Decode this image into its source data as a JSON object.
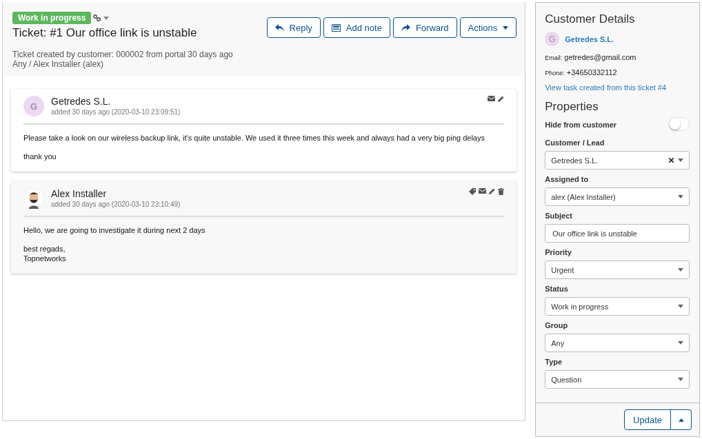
{
  "ticket": {
    "status_badge": "Work in progress",
    "title": "Ticket: #1 Our office link is unstable",
    "created": "Ticket created by customer: 000002 from portal 30 days ago",
    "assignment": "Any / Alex Installer (alex)"
  },
  "toolbar": [
    {
      "kind": "reply",
      "label": "Reply"
    },
    {
      "kind": "note",
      "label": "Add note"
    },
    {
      "kind": "forward",
      "label": "Forward"
    },
    {
      "kind": "dropdown",
      "label": "Actions"
    }
  ],
  "messages": [
    {
      "kind": "customer",
      "author": "Getredes S.L.",
      "avatar_letter": "G",
      "added": "added 30 days ago (2020-03-10 23:09:51)",
      "paragraphs": [
        "Please take a look on our wireless backup link, it's quite unstable. We used it three times this week and always had a very big ping delays",
        "thank you"
      ],
      "actions": [
        {
          "kind": "mail"
        },
        {
          "kind": "edit"
        }
      ]
    },
    {
      "kind": "agent",
      "author": "Alex Installer",
      "added": "added 30 days ago (2020-03-10 23:10:49)",
      "paragraphs": [
        "Hello, we are going to investigate it during next 2 days",
        "best regads,\nTopnetworks"
      ],
      "actions": [
        {
          "kind": "tag"
        },
        {
          "kind": "mail"
        },
        {
          "kind": "edit"
        },
        {
          "kind": "delete"
        }
      ]
    }
  ],
  "customer_details": {
    "title": "Customer Details",
    "avatar_letter": "G",
    "name": "Getredes S.L.",
    "email_label": "Email:",
    "email": "getredes@gmail.com",
    "phone_label": "Phone:",
    "phone": "+34650332112",
    "task_link": "View task created from this ticket #4"
  },
  "properties": {
    "title": "Properties",
    "fields": [
      {
        "kind": "toggle",
        "label": "Hide from customer",
        "on": false
      },
      {
        "kind": "select",
        "label": "Customer / Lead",
        "value": "Getredes S.L.",
        "clearable": true
      },
      {
        "kind": "select",
        "label": "Assigned to",
        "value": "alex (Alex Installer)",
        "clearable": false
      },
      {
        "kind": "text",
        "label": "Subject",
        "value": "Our office link is unstable"
      },
      {
        "kind": "select",
        "label": "Priority",
        "value": "Urgent",
        "clearable": false
      },
      {
        "kind": "select",
        "label": "Status",
        "value": "Work in progress",
        "clearable": false
      },
      {
        "kind": "select",
        "label": "Group",
        "value": "Any",
        "clearable": false
      },
      {
        "kind": "select",
        "label": "Type",
        "value": "Question",
        "clearable": false
      }
    ]
  },
  "update_button": "Update"
}
